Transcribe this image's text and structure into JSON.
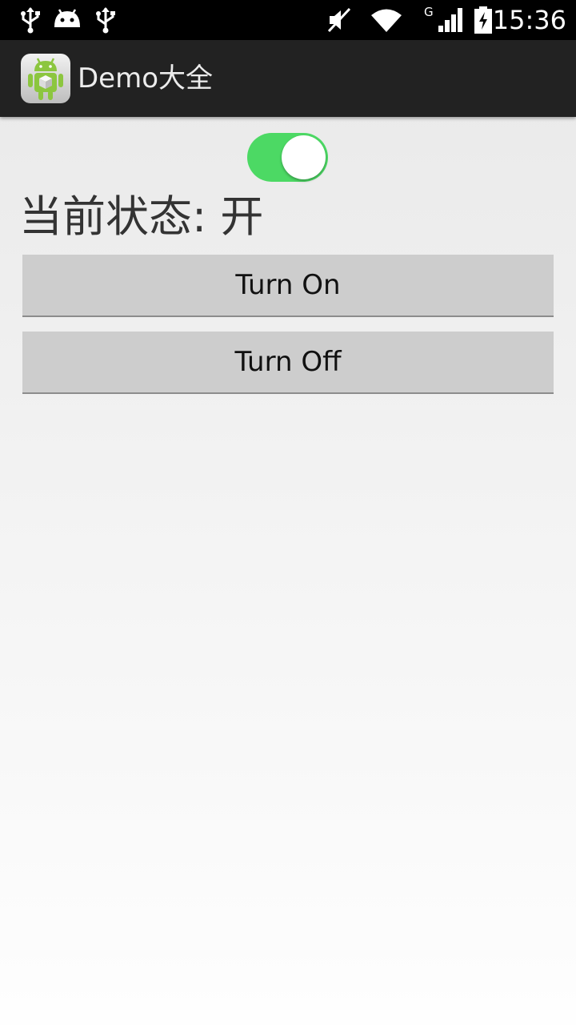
{
  "status_bar": {
    "time": "15:36",
    "network_type": "G",
    "icons": [
      "usb-icon",
      "android-debug-icon",
      "usb-icon",
      "mute-icon",
      "wifi-icon",
      "cell-signal-icon",
      "battery-charging-icon"
    ]
  },
  "action_bar": {
    "title": "Demo大全",
    "icon": "android-app-icon"
  },
  "main": {
    "switch_on": true,
    "status_label": "当前状态: 开",
    "turn_on_label": "Turn On",
    "turn_off_label": "Turn Off"
  },
  "colors": {
    "switch_on": "#4cd964",
    "action_bar": "#222222",
    "button": "#cdcdcd"
  }
}
